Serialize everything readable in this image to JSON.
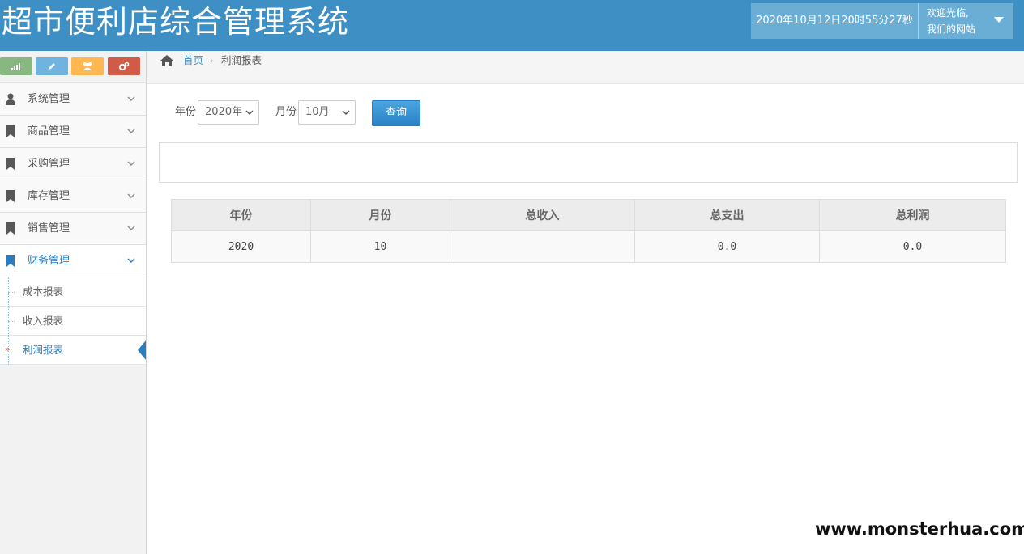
{
  "header": {
    "title": "超市便利店综合管理系统",
    "datetime": "2020年10月12日20时55分27秒",
    "welcome_line1": "欢迎光临,",
    "welcome_line2": "我们的网站"
  },
  "sidebar": {
    "shortcuts": [
      {
        "name": "signal",
        "color": "#87b87f"
      },
      {
        "name": "pencil",
        "color": "#6fb3e0"
      },
      {
        "name": "users",
        "color": "#ffb752"
      },
      {
        "name": "cogs",
        "color": "#d15b47"
      }
    ],
    "items": [
      {
        "label": "系统管理",
        "icon": "user-icon"
      },
      {
        "label": "商品管理",
        "icon": "bookmark-icon"
      },
      {
        "label": "采购管理",
        "icon": "bookmark-icon"
      },
      {
        "label": "库存管理",
        "icon": "bookmark-icon"
      },
      {
        "label": "销售管理",
        "icon": "bookmark-icon"
      },
      {
        "label": "财务管理",
        "icon": "bookmark-icon",
        "active": true
      }
    ],
    "subitems": [
      {
        "label": "成本报表"
      },
      {
        "label": "收入报表"
      },
      {
        "label": "利润报表",
        "active": true
      }
    ]
  },
  "breadcrumb": {
    "home": "首页",
    "current": "利润报表"
  },
  "filter": {
    "year_label": "年份",
    "year_value": "2020年",
    "month_label": "月份",
    "month_value": "10月",
    "query_label": "查询"
  },
  "table": {
    "headers": [
      "年份",
      "月份",
      "总收入",
      "总支出",
      "总利润"
    ],
    "rows": [
      [
        "2020",
        "10",
        "",
        "0.0",
        "0.0"
      ]
    ]
  },
  "watermark": "www.monsterhua.com",
  "colors": {
    "header_bg": "#3d8fc4",
    "accent": "#2b7dbc"
  }
}
